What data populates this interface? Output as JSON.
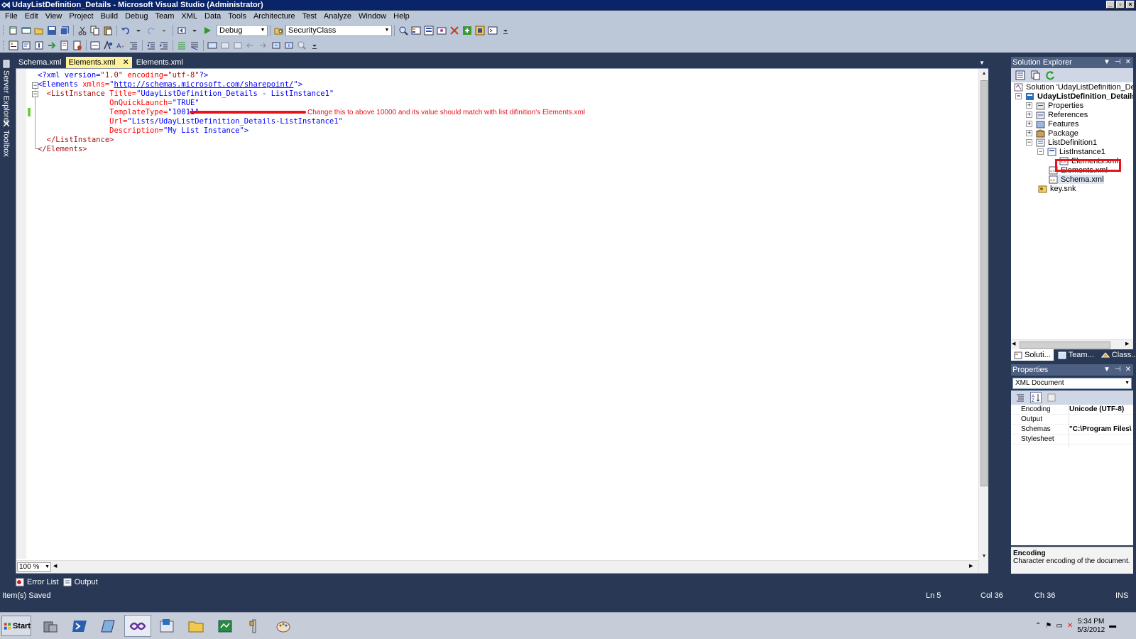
{
  "window": {
    "title": "UdayListDefinition_Details - Microsoft Visual Studio (Administrator)"
  },
  "menu": [
    "File",
    "Edit",
    "View",
    "Project",
    "Build",
    "Debug",
    "Team",
    "XML",
    "Data",
    "Tools",
    "Architecture",
    "Test",
    "Analyze",
    "Window",
    "Help"
  ],
  "toolbar": {
    "config": "Debug",
    "startup_item": "SecurityClass"
  },
  "left_dock": {
    "server_explorer": "Server Explorer",
    "toolbox": "Toolbox"
  },
  "doc_tabs": [
    {
      "label": "Schema.xml"
    },
    {
      "label": "Elements.xml",
      "active": true
    },
    {
      "label": "Elements.xml"
    }
  ],
  "editor": {
    "lines": {
      "l1_a": "<?xml version=",
      "l1_b": "\"1.0\"",
      "l1_c": " encoding=",
      "l1_d": "\"utf-8\"",
      "l1_e": "?>",
      "l2_a": "<Elements",
      "l2_b": " xmlns=",
      "l2_c": "\"",
      "l2_url": "http://schemas.microsoft.com/sharepoint/",
      "l2_d": "\"",
      "l2_e": ">",
      "l3_a": "  <ListInstance",
      "l3_b": " Title=",
      "l3_c": "\"UdayListDefinition_Details - ListInstance1\"",
      "l4_a": "                OnQuickLaunch=",
      "l4_b": "\"TRUE\"",
      "l5_a": "                TemplateType=",
      "l5_b": "\"10011\"",
      "l6_a": "                Url=",
      "l6_b": "\"Lists/UdayListDefinition_Details-ListInstance1\"",
      "l7_a": "                Description=",
      "l7_b": "\"My List Instance\"",
      "l7_c": ">",
      "l8_a": "  </ListInstance>",
      "l9_a": "</Elements>"
    },
    "annotation": "Change this to above 10000 and its value should match with list difinition's Elements.xml",
    "zoom": "100 %"
  },
  "bottom_tabs": [
    "Error List",
    "Output"
  ],
  "status": {
    "message": "Item(s) Saved",
    "ln": "Ln 5",
    "col": "Col 36",
    "ch": "Ch 36",
    "mode": "INS"
  },
  "solution_explorer": {
    "title": "Solution Explorer",
    "nodes": {
      "solution": "Solution 'UdayListDefinition_Details'",
      "project": "UdayListDefinition_Details",
      "properties": "Properties",
      "references": "References",
      "features": "Features",
      "package": "Package",
      "listdef": "ListDefinition1",
      "listinstance": "ListInstance1",
      "li_elements": "Elements.xml",
      "ld_elements": "Elements.xml",
      "schema": "Schema.xml",
      "key": "key.snk"
    },
    "tabs": [
      "Soluti...",
      "Team...",
      "Class..."
    ]
  },
  "properties": {
    "title": "Properties",
    "object": "XML Document",
    "rows": [
      {
        "name": "Encoding",
        "value": "Unicode (UTF-8)"
      },
      {
        "name": "Output",
        "value": ""
      },
      {
        "name": "Schemas",
        "value": "\"C:\\Program Files\\"
      },
      {
        "name": "Stylesheet",
        "value": ""
      }
    ],
    "desc_title": "Encoding",
    "desc_text": "Character encoding of the document."
  },
  "taskbar": {
    "start": "Start",
    "time": "5:34 PM",
    "date": "5/3/2012"
  },
  "colors": {
    "accent": "#293955",
    "annotation": "#e8141c",
    "tab_active": "#fff29d"
  }
}
